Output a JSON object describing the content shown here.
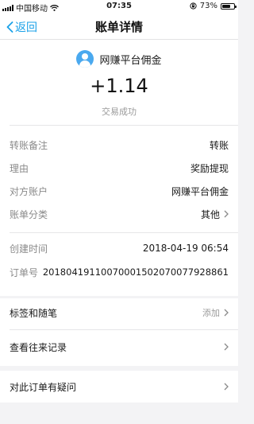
{
  "status_bar": {
    "carrier": "中国移动",
    "time": "07:35",
    "battery_percent": "73%",
    "battery_level": 0.73
  },
  "nav": {
    "back_label": "返回",
    "title": "账单详情"
  },
  "payee": {
    "name": "网赚平台佣金",
    "amount": "+1.14",
    "status": "交易成功"
  },
  "details": [
    {
      "label": "转账备注",
      "value": "转账"
    },
    {
      "label": "理由",
      "value": "奖励提现"
    },
    {
      "label": "对方账户",
      "value": "网赚平台佣金"
    },
    {
      "label": "账单分类",
      "value": "其他"
    }
  ],
  "meta": [
    {
      "label": "创建时间",
      "value": "2018-04-19 06:54"
    },
    {
      "label": "订单号",
      "value": "20180419110070001502070077928861"
    }
  ],
  "actions": {
    "tags_label": "标签和随笔",
    "tags_add": "添加",
    "history_label": "查看往来记录",
    "question_label": "对此订单有疑问"
  },
  "colors": {
    "accent": "#1aa1e8",
    "avatar": "#4aa9ef"
  }
}
